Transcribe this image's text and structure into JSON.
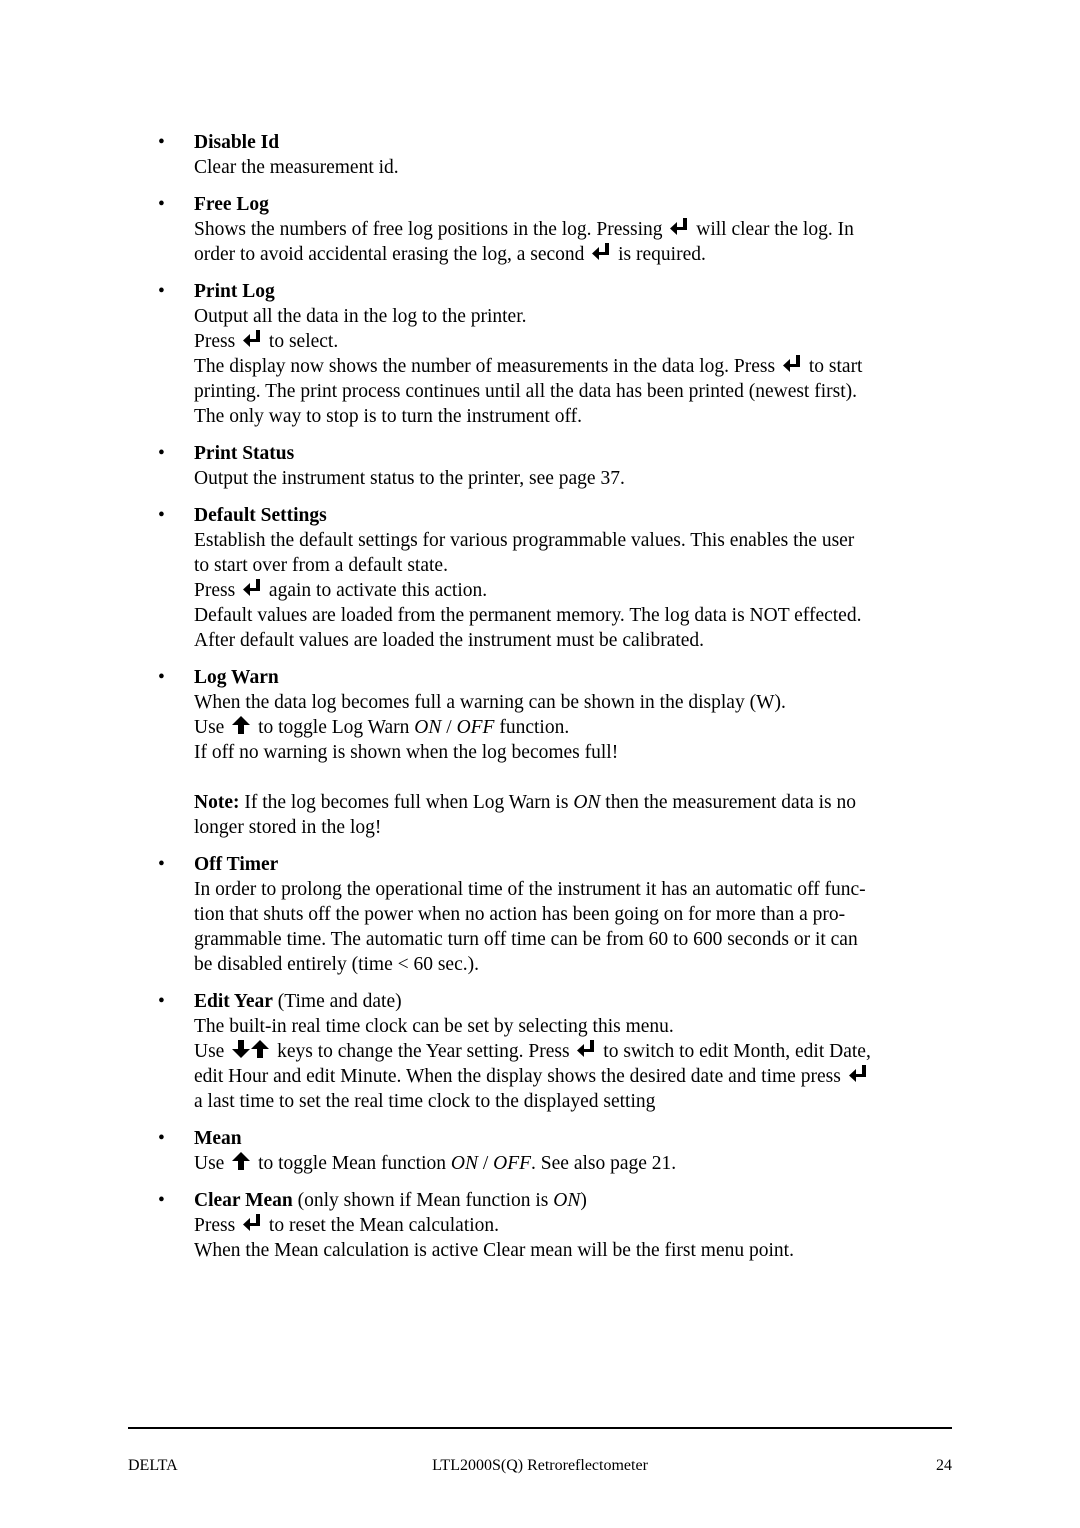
{
  "items": [
    {
      "title": "Disable Id",
      "lines": [
        "Clear the measurement id."
      ]
    },
    {
      "title": "Free Log",
      "line1_a": "Shows the numbers of free log positions in the log. Pressing",
      "line1_b": "will clear the log. In",
      "line2_a": "order to avoid accidental erasing the log, a second",
      "line2_b": "is required."
    },
    {
      "title": "Print Log",
      "line1": "Output all the data in the log to the printer.",
      "line2_a": "Press",
      "line2_b": "to select.",
      "line3_a": "The display now shows the number of measurements in the data log. Press",
      "line3_b": "to start",
      "line4": "printing. The print process continues until all the data has been printed (newest first).",
      "line5": "The only way to stop is to turn the instrument off."
    },
    {
      "title": "Print Status",
      "line1": "Output the instrument status to the printer, see page 37."
    },
    {
      "title": "Default Settings",
      "line1": "Establish the default settings for various programmable values. This enables the user",
      "line2": "to start over from a default state.",
      "line3_a": "Press",
      "line3_b": "again to activate this action.",
      "line4": "Default values are loaded from the permanent memory. The log data is NOT effected.",
      "line5": "After default values are loaded the instrument must be calibrated."
    },
    {
      "title": "Log Warn",
      "line1": "When the data log becomes full a warning can be shown in the display (W).",
      "line2_a": "Use",
      "line2_b": "to toggle Log Warn",
      "line2_on": "ON",
      "line2_sep": " / ",
      "line2_off": "OFF",
      "line2_c": "function.",
      "line3": "If off no warning is shown when the log becomes full!",
      "note_label": "Note:",
      "note_a": "If the log becomes full when Log Warn is",
      "note_on": "ON",
      "note_b": "then the measurement data is no",
      "note_line2": "longer stored in the log!"
    },
    {
      "title": "Off Timer",
      "line1": "In order to prolong the operational time of the instrument it has an automatic off func-",
      "line2": "tion that shuts off the power when no action has been going on for more than a pro-",
      "line3": "grammable time. The automatic turn off time can be from 60 to 600 seconds or it can",
      "line4": "be disabled entirely (time < 60 sec.)."
    },
    {
      "title": "Edit Year",
      "title_suffix": "(Time and date)",
      "line1": "The built-in real time clock can be set by selecting this menu.",
      "line2_a": "Use",
      "line2_b": "keys to change the Year setting. Press",
      "line2_c": "to switch to edit Month, edit Date,",
      "line3_a": "edit Hour and edit Minute. When the display shows the desired date and time press",
      "line4": "a last time to set the real time clock to the displayed setting"
    },
    {
      "title": "Mean",
      "line1_a": "Use",
      "line1_b": "to toggle Mean function",
      "line1_on": "ON",
      "line1_sep": " / ",
      "line1_off": "OFF",
      "line1_c": ". See also page 21."
    },
    {
      "title": "Clear Mean",
      "title_suffix_a": "(only shown if Mean function is",
      "title_suffix_on": "ON",
      "title_suffix_b": ")",
      "line1_a": "Press",
      "line1_b": "to reset the Mean calculation.",
      "line2": "When the Mean calculation is active Clear mean will be the first menu point."
    }
  ],
  "icons": {
    "enter": "enter-key-icon",
    "up": "up-arrow-key-icon",
    "down": "down-arrow-key-icon"
  },
  "footer": {
    "left": "DELTA",
    "center": "LTL2000S(Q) Retroreflectometer",
    "page": "24"
  }
}
